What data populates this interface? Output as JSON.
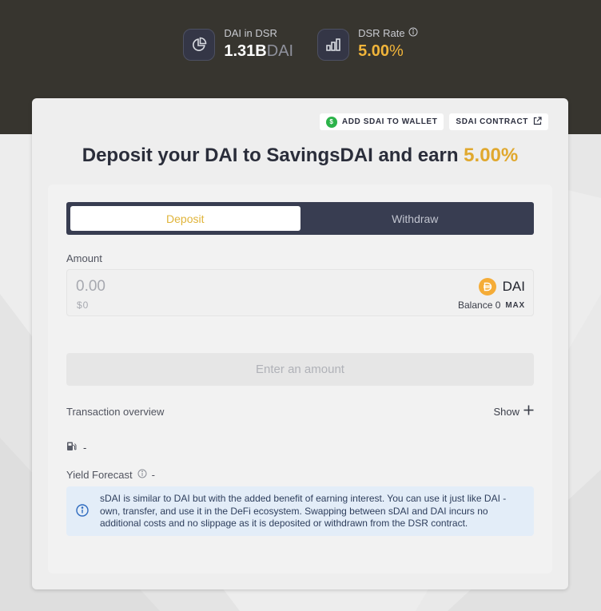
{
  "stats": {
    "dsr_label": "DAI in DSR",
    "dsr_amount": "1.31B",
    "dsr_unit": "DAI",
    "rate_label": "DSR Rate",
    "rate_value": "5.00",
    "rate_unit": "%"
  },
  "actions": {
    "add_wallet": "ADD SDAI TO WALLET",
    "contract": "SDAI CONTRACT"
  },
  "title": {
    "prefix": "Deposit your DAI to SavingsDAI and earn ",
    "rate": "5.00%"
  },
  "tabs": [
    "Deposit",
    "Withdraw"
  ],
  "amount": {
    "label": "Amount",
    "placeholder": "0.00",
    "usd": "$0",
    "token": "DAI",
    "balance": "Balance 0",
    "max": "MAX"
  },
  "submit_label": "Enter an amount",
  "overview": {
    "label": "Transaction overview",
    "show": "Show",
    "gas_value": "-",
    "yield_label": "Yield Forecast",
    "yield_value": "-"
  },
  "info_text": "sDAI is similar to DAI but with the added benefit of earning interest. You can use it just like DAI - own, transfer, and use it in the DeFi ecosystem. Swapping between sDAI and DAI incurs no additional costs and no slippage as it is deposited or withdrawn from the DSR contract.",
  "colors": {
    "hero_bg": "#37352f",
    "accent": "#e0a82e",
    "tab_bg": "#383d51",
    "info_bg": "#e3edf8"
  }
}
